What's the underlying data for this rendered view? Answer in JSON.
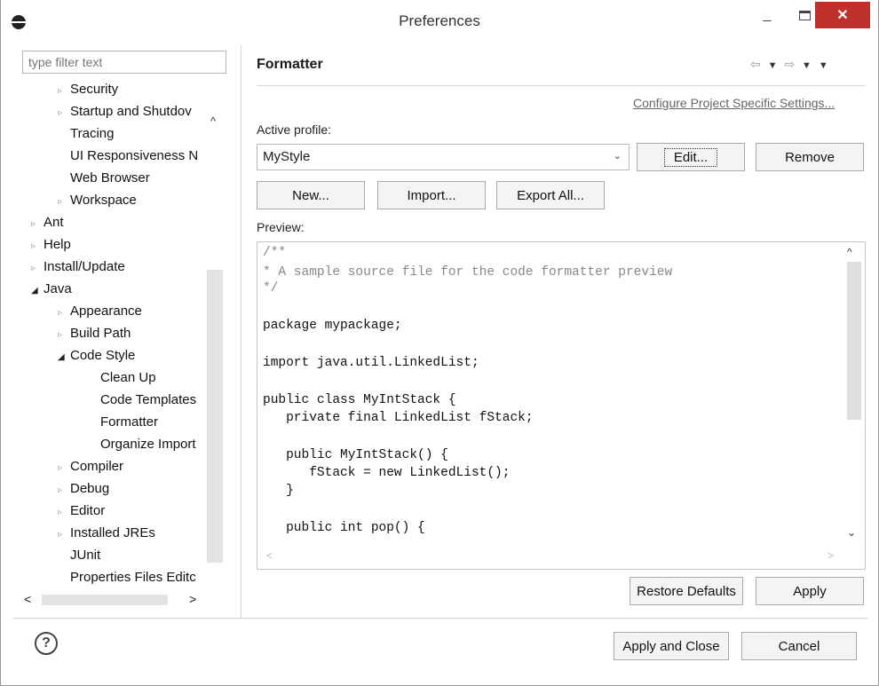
{
  "window": {
    "title": "Preferences",
    "minimize": "_",
    "close": "✕"
  },
  "left": {
    "filter_placeholder": "type filter text",
    "tree": [
      {
        "label": "Security",
        "arrow": "▹"
      },
      {
        "label": "Startup and Shutdov",
        "arrow": "▹"
      },
      {
        "label": "Tracing",
        "arrow": ""
      },
      {
        "label": "UI Responsiveness N",
        "arrow": ""
      },
      {
        "label": "Web Browser",
        "arrow": ""
      },
      {
        "label": "Workspace",
        "arrow": "▹"
      },
      {
        "label": "Ant",
        "arrow": "▹"
      },
      {
        "label": "Help",
        "arrow": "▹"
      },
      {
        "label": "Install/Update",
        "arrow": "▹"
      },
      {
        "label": "Java",
        "arrow": "◢"
      },
      {
        "label": "Appearance",
        "arrow": "▹"
      },
      {
        "label": "Build Path",
        "arrow": "▹"
      },
      {
        "label": "Code Style",
        "arrow": "◢"
      },
      {
        "label": "Clean Up",
        "arrow": ""
      },
      {
        "label": "Code Templates",
        "arrow": ""
      },
      {
        "label": "Formatter",
        "arrow": ""
      },
      {
        "label": "Organize Import",
        "arrow": ""
      },
      {
        "label": "Compiler",
        "arrow": "▹"
      },
      {
        "label": "Debug",
        "arrow": "▹"
      },
      {
        "label": "Editor",
        "arrow": "▹"
      },
      {
        "label": "Installed JREs",
        "arrow": "▹"
      },
      {
        "label": "JUnit",
        "arrow": ""
      },
      {
        "label": "Properties Files Editc",
        "arrow": ""
      }
    ],
    "scroll_up": "^",
    "scroll_down": "⌄",
    "scroll_left": "<",
    "scroll_right": ">"
  },
  "main": {
    "title": "Formatter",
    "nav_back": "⇦",
    "nav_forward": "⇨",
    "nav_dropdown": "▼",
    "project_link": "Configure Project Specific Settings...",
    "active_profile_label": "Active profile:",
    "profile_value": "MyStyle",
    "profile_caret": "⌄",
    "edit_label": "Edit...",
    "remove_label": "Remove",
    "new_label": "New...",
    "import_label": "Import...",
    "export_label": "Export All...",
    "preview_label": "Preview:",
    "preview_scroll_up": "^",
    "preview_scroll_down": "⌄",
    "preview_scroll_left": "<",
    "preview_scroll_right": ">",
    "code": [
      {
        "text": "/**",
        "comment": true
      },
      {
        "text": "* A sample source file for the code formatter preview",
        "comment": true
      },
      {
        "text": "*/",
        "comment": true
      },
      {
        "text": "",
        "comment": false
      },
      {
        "text": "package mypackage;",
        "comment": false
      },
      {
        "text": "",
        "comment": false
      },
      {
        "text": "import java.util.LinkedList;",
        "comment": false
      },
      {
        "text": "",
        "comment": false
      },
      {
        "text": "public class MyIntStack {",
        "comment": false
      },
      {
        "text": "   private final LinkedList fStack;",
        "comment": false
      },
      {
        "text": "",
        "comment": false
      },
      {
        "text": "   public MyIntStack() {",
        "comment": false
      },
      {
        "text": "      fStack = new LinkedList();",
        "comment": false
      },
      {
        "text": "   }",
        "comment": false
      },
      {
        "text": "",
        "comment": false
      },
      {
        "text": "   public int pop() {",
        "comment": false
      }
    ],
    "restore_defaults_label": "Restore Defaults",
    "apply_label": "Apply"
  },
  "footer": {
    "help": "?",
    "apply_close_label": "Apply and Close",
    "cancel_label": "Cancel"
  }
}
